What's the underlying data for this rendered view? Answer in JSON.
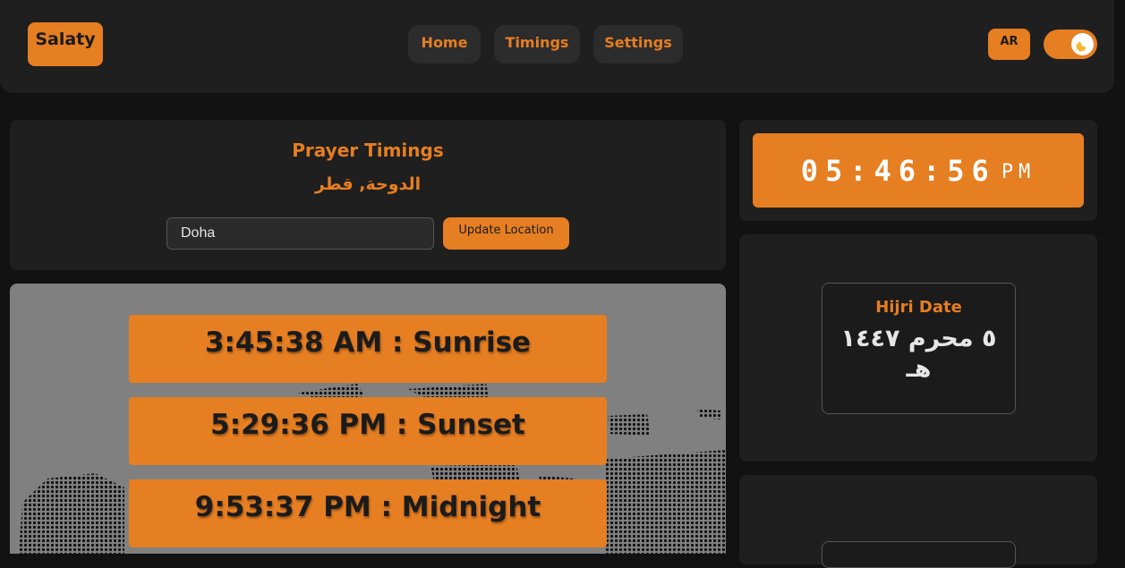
{
  "header": {
    "logo": "Salaty",
    "nav": [
      {
        "label": "Home"
      },
      {
        "label": "Timings"
      },
      {
        "label": "Settings"
      }
    ],
    "lang_button": "AR",
    "theme_toggle_icon": "moon-icon"
  },
  "location": {
    "title": "Prayer Timings",
    "city_arabic": "الدوحة, قطر",
    "input_value": "Doha",
    "update_label": "Update Location"
  },
  "prayers": [
    {
      "text": "3:45:38 AM : Sunrise"
    },
    {
      "text": "5:29:36 PM : Sunset"
    },
    {
      "text": "9:53:37 PM : Midnight"
    }
  ],
  "clock": {
    "time": "05:46:56",
    "ampm": "PM"
  },
  "hijri": {
    "label": "Hijri Date",
    "date": "٥ محرم ١٤٤٧ هـ"
  },
  "colors": {
    "accent": "#e67e22",
    "background": "#121212",
    "panel": "#1f1f1f",
    "map": "#808080"
  }
}
